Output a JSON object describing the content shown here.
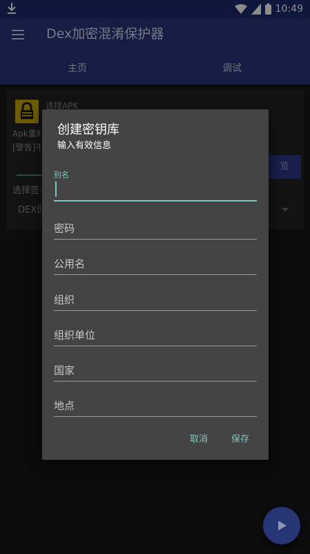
{
  "status_bar": {
    "time": "10:49"
  },
  "app": {
    "title": "Dex加密混淆保护器",
    "tabs": [
      {
        "label": "主页"
      },
      {
        "label": "调试"
      }
    ]
  },
  "background_card": {
    "title": "选择APK",
    "line1": "Apk重新",
    "line2": "[警告]不",
    "browse_label": "览",
    "sign_label": "选择签名",
    "select_value": "DEX保护"
  },
  "dialog": {
    "title": "创建密钥库",
    "subtitle": "输入有效信息",
    "fields": [
      {
        "label": "别名",
        "value": ""
      },
      {
        "label": "密码"
      },
      {
        "label": "公用名"
      },
      {
        "label": "组织"
      },
      {
        "label": "组织单位"
      },
      {
        "label": "国家"
      },
      {
        "label": "地点"
      }
    ],
    "cancel_label": "取消",
    "save_label": "保存"
  },
  "colors": {
    "app_bar": "#27357e",
    "accent": "#7fc7bf",
    "dialog_bg": "#434343"
  },
  "icons": {
    "menu": "menu-icon",
    "lock": "lock-icon",
    "play": "play-icon"
  }
}
